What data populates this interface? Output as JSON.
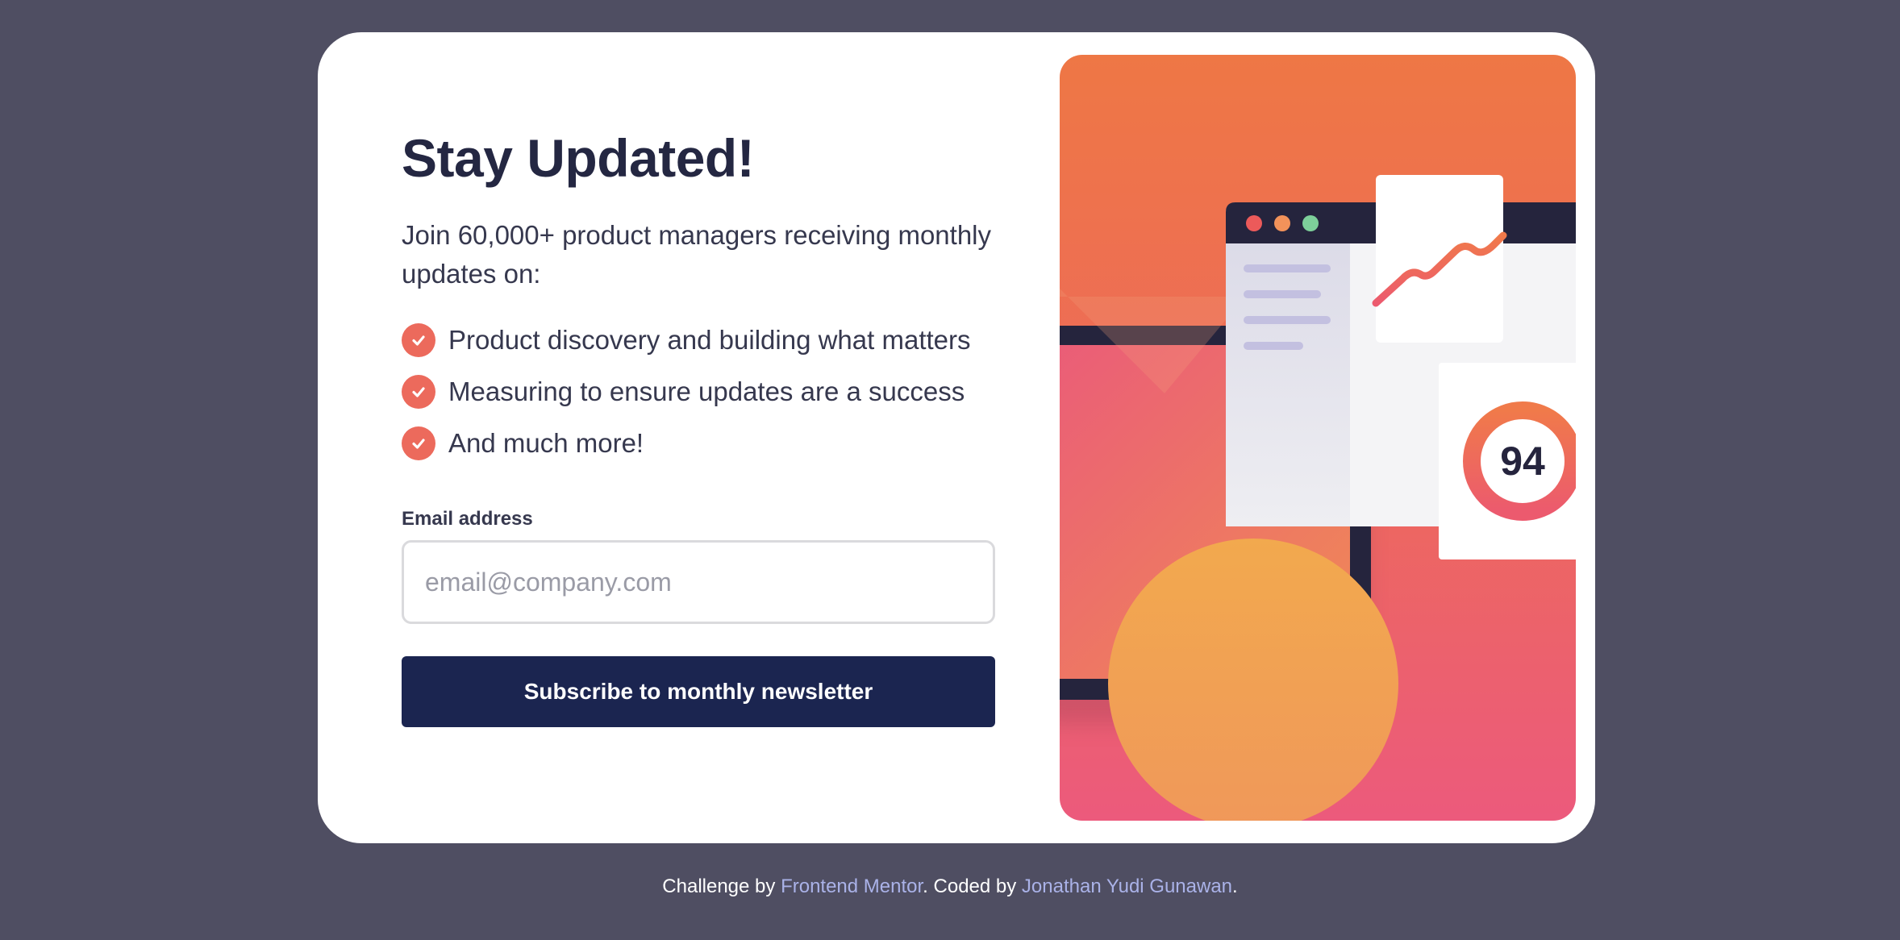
{
  "signup": {
    "title": "Stay Updated!",
    "intro": "Join 60,000+ product managers receiving monthly updates on:",
    "features": [
      "Product discovery and building what matters",
      "Measuring to ensure updates are a success",
      "And much more!"
    ],
    "email_label": "Email address",
    "email_placeholder": "email@company.com",
    "email_value": "",
    "submit_label": "Subscribe to monthly newsletter"
  },
  "illustration": {
    "score": "94",
    "icons": [
      "check-icon",
      "browser-window-icon",
      "line-chart-icon",
      "score-ring-icon"
    ],
    "colors": {
      "accent": "#ec6a5c",
      "button": "#1b2550",
      "background": "#4f4e62",
      "gradient_top": "#ee7745",
      "gradient_bottom": "#ec5a7c"
    }
  },
  "footer": {
    "prefix": "Challenge by ",
    "link1": "Frontend Mentor",
    "middle": ". Coded by ",
    "link2": "Jonathan Yudi Gunawan",
    "suffix": "."
  }
}
